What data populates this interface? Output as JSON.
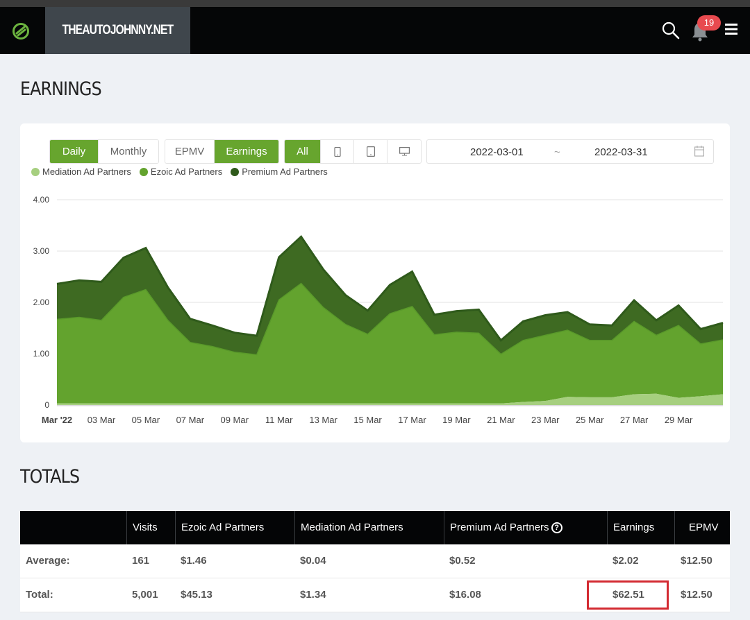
{
  "header": {
    "site_name": "THEAUTOJOHNNY.NET",
    "notification_count": "19",
    "logo_icon": "ezoic-logo-icon",
    "search_icon": "search-icon",
    "bell_icon": "bell-icon",
    "menu_icon": "hamburger-menu-icon"
  },
  "earnings": {
    "title": "EARNINGS",
    "period_buttons": [
      {
        "label": "Daily",
        "active": true
      },
      {
        "label": "Monthly",
        "active": false
      }
    ],
    "metric_buttons": [
      {
        "label": "EPMV",
        "active": false
      },
      {
        "label": "Earnings",
        "active": true
      }
    ],
    "device_buttons": [
      {
        "label": "All",
        "active": true
      },
      {
        "icon": "mobile-icon",
        "active": false
      },
      {
        "icon": "tablet-icon",
        "active": false
      },
      {
        "icon": "desktop-icon",
        "active": false
      }
    ],
    "date_start": "2022-03-01",
    "date_separator": "~",
    "date_end": "2022-03-31",
    "calendar_icon": "calendar-icon",
    "colors": {
      "accent": "#67a52e",
      "mediation": "#a6cf7f",
      "ezoic": "#63a32e",
      "premium": "#3e6a22",
      "premium_line": "#2f5a1b"
    }
  },
  "chart_data": {
    "type": "area",
    "stacked": true,
    "ylim": [
      0,
      4
    ],
    "y_ticks": [
      "4.00",
      "3.00",
      "2.00",
      "1.00",
      "0"
    ],
    "x_tick_labels": [
      "Mar '22",
      "03 Mar",
      "05 Mar",
      "07 Mar",
      "09 Mar",
      "11 Mar",
      "13 Mar",
      "15 Mar",
      "17 Mar",
      "19 Mar",
      "21 Mar",
      "23 Mar",
      "25 Mar",
      "27 Mar",
      "29 Mar"
    ],
    "x": [
      1,
      2,
      3,
      4,
      5,
      6,
      7,
      8,
      9,
      10,
      11,
      12,
      13,
      14,
      15,
      16,
      17,
      18,
      19,
      20,
      21,
      22,
      23,
      24,
      25,
      26,
      27,
      28,
      29,
      30,
      31
    ],
    "legend": [
      "Mediation Ad Partners",
      "Ezoic Ad Partners",
      "Premium Ad Partners"
    ],
    "legend_position": "top-left",
    "grid": true,
    "series": [
      {
        "name": "Mediation Ad Partners",
        "values": [
          0.03,
          0.03,
          0.03,
          0.03,
          0.03,
          0.03,
          0.03,
          0.03,
          0.03,
          0.03,
          0.03,
          0.03,
          0.03,
          0.03,
          0.03,
          0.03,
          0.03,
          0.03,
          0.03,
          0.03,
          0.03,
          0.06,
          0.08,
          0.16,
          0.15,
          0.15,
          0.21,
          0.22,
          0.14,
          0.17,
          0.21
        ]
      },
      {
        "name": "Ezoic Ad Partners",
        "values": [
          1.64,
          1.68,
          1.62,
          2.07,
          2.22,
          1.62,
          1.19,
          1.11,
          1.0,
          0.95,
          2.02,
          2.34,
          1.87,
          1.54,
          1.35,
          1.75,
          1.89,
          1.34,
          1.39,
          1.37,
          0.96,
          1.2,
          1.28,
          1.3,
          1.11,
          1.11,
          1.42,
          1.14,
          1.41,
          1.02,
          1.06
        ]
      },
      {
        "name": "Premium Ad Partners",
        "values": [
          0.69,
          0.72,
          0.75,
          0.77,
          0.81,
          0.64,
          0.46,
          0.41,
          0.38,
          0.37,
          0.83,
          0.91,
          0.74,
          0.57,
          0.46,
          0.56,
          0.68,
          0.39,
          0.41,
          0.46,
          0.27,
          0.37,
          0.39,
          0.35,
          0.31,
          0.29,
          0.41,
          0.29,
          0.39,
          0.29,
          0.33
        ]
      }
    ]
  },
  "totals": {
    "title": "TOTALS",
    "columns": [
      "",
      "Visits",
      "Ezoic Ad Partners",
      "Mediation Ad Partners",
      "Premium Ad Partners",
      "Earnings",
      "EPMV"
    ],
    "help_icon": "question-circle-icon",
    "rows": [
      {
        "label": "Average:",
        "visits": "161",
        "ezoic": "$1.46",
        "mediation": "$0.04",
        "premium": "$0.52",
        "earnings": "$2.02",
        "epmv": "$12.50"
      },
      {
        "label": "Total:",
        "visits": "5,001",
        "ezoic": "$45.13",
        "mediation": "$1.34",
        "premium": "$16.08",
        "earnings": "$62.51",
        "epmv": "$12.50"
      }
    ]
  }
}
